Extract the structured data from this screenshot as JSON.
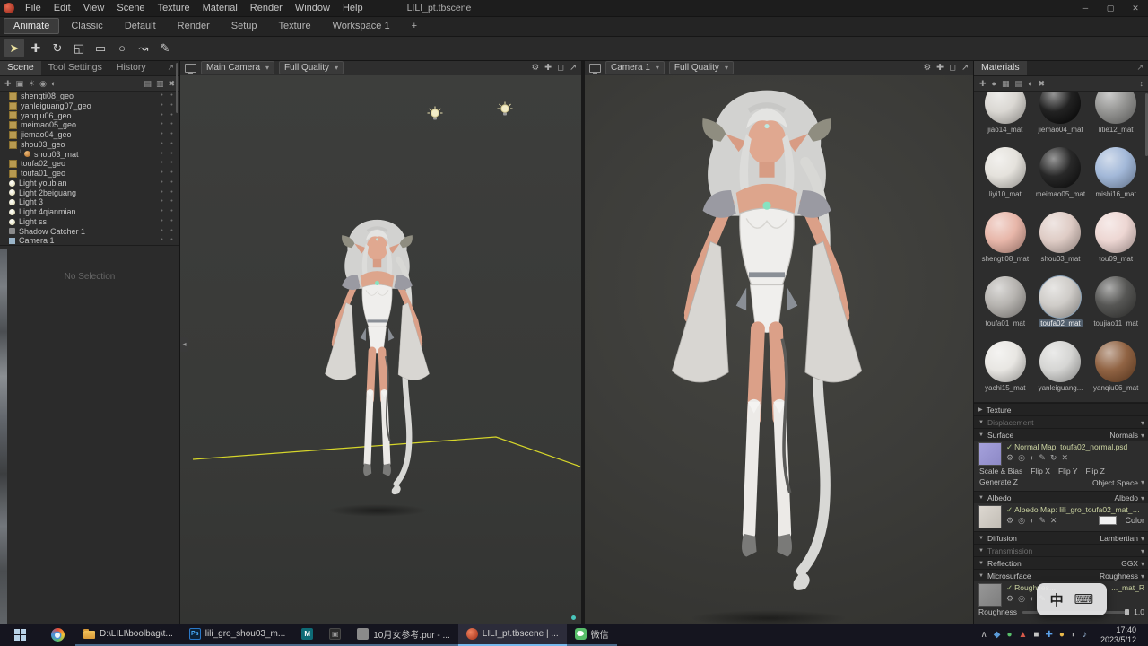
{
  "colors": {
    "accent_blue": "#76b9ed",
    "viewport_bg": "#3c3d3b",
    "panel_bg": "#2d2d2d",
    "selection_bg": "#53606e",
    "ground_outline_yellow": "#d6d62a",
    "wechat_green": "#58be6a",
    "photoshop_blue": "#31a8ff",
    "marmoset_red": "#c84a30"
  },
  "icons": {
    "select-arrow-icon": "➤",
    "translate-tool-icon": "✚",
    "rotate-tool-icon": "↻",
    "scale-tool-icon": "◱",
    "gear-icon": "⚙",
    "external-link-icon": "↗",
    "keyboard-icon": "⌨",
    "light-gizmo-icon": "bulb"
  },
  "window": {
    "menu": [
      "File",
      "Edit",
      "View",
      "Scene",
      "Texture",
      "Material",
      "Render",
      "Window",
      "Help"
    ],
    "title": "LILI_pt.tbscene"
  },
  "workspace_tabs": [
    {
      "label": "Animate",
      "state": "active"
    },
    {
      "label": "Classic"
    },
    {
      "label": "Default"
    },
    {
      "label": "Render"
    },
    {
      "label": "Setup"
    },
    {
      "label": "Texture"
    },
    {
      "label": "Workspace 1"
    },
    {
      "label": "+"
    }
  ],
  "toolbar_tools": [
    {
      "name": "select-arrow-icon",
      "glyph": "➤",
      "state": "active"
    },
    {
      "name": "translate-tool-icon",
      "glyph": "✚"
    },
    {
      "name": "rotate-tool-icon",
      "glyph": "↻"
    },
    {
      "name": "scale-tool-icon",
      "glyph": "◱"
    },
    {
      "name": "rect-select-icon",
      "glyph": "▭"
    },
    {
      "name": "ellipse-select-icon",
      "glyph": "○"
    },
    {
      "name": "lasso-select-icon",
      "glyph": "↝"
    },
    {
      "name": "pen-select-icon",
      "glyph": "✎"
    }
  ],
  "scene_panel": {
    "tabs": [
      {
        "label": "Scene",
        "state": "active"
      },
      {
        "label": "Tool Settings"
      },
      {
        "label": "History"
      }
    ],
    "tree": [
      {
        "label": "shengti08_geo",
        "state": "geo",
        "icon": "mesh-icon"
      },
      {
        "label": "yanleiguang07_geo",
        "state": "geo",
        "icon": "mesh-icon"
      },
      {
        "label": "yanqiu06_geo",
        "state": "geo",
        "icon": "mesh-icon"
      },
      {
        "label": "meimao05_geo",
        "state": "geo",
        "icon": "mesh-icon"
      },
      {
        "label": "jiemao04_geo",
        "state": "geo",
        "icon": "mesh-icon"
      },
      {
        "label": "shou03_geo",
        "state": "geo",
        "icon": "mesh-icon"
      },
      {
        "label": "shou03_mat",
        "state": "mat child",
        "icon": "material-icon"
      },
      {
        "label": "toufa02_geo",
        "state": "geo",
        "icon": "mesh-icon"
      },
      {
        "label": "toufa01_geo",
        "state": "geo",
        "icon": "mesh-icon"
      },
      {
        "label": "Light youbian",
        "state": "light",
        "icon": "light-icon"
      },
      {
        "label": "Light 2beiguang",
        "state": "light",
        "icon": "light-icon"
      },
      {
        "label": "Light 3",
        "state": "light",
        "icon": "light-icon"
      },
      {
        "label": "Light 4qianmian",
        "state": "light",
        "icon": "light-icon"
      },
      {
        "label": "Light ss",
        "state": "light",
        "icon": "light-icon"
      },
      {
        "label": "Shadow Catcher 1",
        "state": "shadow",
        "icon": "shadow-catcher-icon"
      },
      {
        "label": "Camera 1",
        "state": "camera",
        "icon": "camera-icon"
      }
    ],
    "empty_text": "No Selection"
  },
  "viewports": [
    {
      "camera": "Main Camera",
      "quality": "Full Quality"
    },
    {
      "camera": "Camera 1",
      "quality": "Full Quality"
    }
  ],
  "materials_panel": {
    "title": "Materials",
    "materials": [
      {
        "label": "jiao14_mat",
        "color": "#d8d5d0"
      },
      {
        "label": "jiemao04_mat",
        "color": "#141414"
      },
      {
        "label": "litie12_mat",
        "color": "#8f8f8d"
      },
      {
        "label": "liyi10_mat",
        "color": "#e3e0da"
      },
      {
        "label": "meimao05_mat",
        "color": "#1b1b1b"
      },
      {
        "label": "mishi16_mat",
        "color": "#9db4d6"
      },
      {
        "label": "shengti08_mat",
        "color": "#e6b2a4"
      },
      {
        "label": "shou03_mat",
        "color": "#ddc9c2"
      },
      {
        "label": "tou09_mat",
        "color": "#ecd4d0"
      },
      {
        "label": "toufa01_mat",
        "color": "#b2afab"
      },
      {
        "label": "toufa02_mat",
        "color": "#ccc9c5",
        "state": "selected"
      },
      {
        "label": "toujiao11_mat",
        "color": "#4c4c4a"
      },
      {
        "label": "yachi15_mat",
        "color": "#e7e5e1"
      },
      {
        "label": "yanleiguang...",
        "color": "#d3d3d1"
      },
      {
        "label": "yanqiu06_mat",
        "color": "#8a5a38"
      }
    ]
  },
  "props": {
    "texture_header": "Texture",
    "displacement": {
      "label": "Displacement"
    },
    "surface": {
      "label": "Surface",
      "value": "Normals"
    },
    "normal_map": {
      "check": "✓",
      "label": "Normal Map: toufa02_normal.psd",
      "row1": [
        "Scale & Bias",
        "Flip X",
        "Flip Y",
        "Flip Z"
      ],
      "row2_left": "Generate Z",
      "row2_right": "Object Space"
    },
    "albedo": {
      "label": "Albedo",
      "value": "Albedo"
    },
    "albedo_map": {
      "check": "✓",
      "label": "Albedo Map: lili_gro_toufa02_mat_Base...",
      "color_label": "Color"
    },
    "diffusion": {
      "label": "Diffusion",
      "value": "Lambertian"
    },
    "transmission": {
      "label": "Transmission"
    },
    "reflection": {
      "label": "Reflection",
      "value": "GGX"
    },
    "microsurface": {
      "label": "Microsurface",
      "value": "Roughness"
    },
    "roughness_map": {
      "check": "✓",
      "label": "Roughnes...",
      "suffix": "..._mat_R"
    },
    "roughness_row": {
      "label": "Roughness",
      "value": "1.0"
    }
  },
  "ime_popup": {
    "mode": "中"
  },
  "taskbar": {
    "apps": [
      {
        "label": "D:\\LILI\\boolbag\\t..."
      },
      {
        "icon_text": "Ps",
        "label": "lili_gro_shou03_m..."
      },
      {
        "icon_text": "M",
        "label": ""
      },
      {
        "label": ""
      },
      {
        "label": "10月女参考.pur - ..."
      },
      {
        "label": "LILI_pt.tbscene | ...",
        "state": "active"
      },
      {
        "label": "微信"
      }
    ],
    "tray_icons": [
      {
        "name": "tray-expand-icon",
        "glyph": "∧",
        "color": "#c0c0c0"
      },
      {
        "name": "tray-icon",
        "glyph": "◆",
        "color": "#5a9ad8"
      },
      {
        "name": "tray-icon",
        "glyph": "●",
        "color": "#58be6a"
      },
      {
        "name": "tray-icon",
        "glyph": "▲",
        "color": "#d85a4a"
      },
      {
        "name": "tray-icon",
        "glyph": "■",
        "color": "#c4c4c4"
      },
      {
        "name": "tray-icon",
        "glyph": "✚",
        "color": "#5aa0e8"
      },
      {
        "name": "tray-icon",
        "glyph": "●",
        "color": "#e8b84a"
      },
      {
        "name": "tray-icon",
        "glyph": "◗",
        "color": "#b0b0b0"
      },
      {
        "name": "tray-icon",
        "glyph": "♪",
        "color": "#9ab8d8"
      }
    ],
    "clock": {
      "time": "17:40",
      "date": "2023/5/12"
    }
  }
}
